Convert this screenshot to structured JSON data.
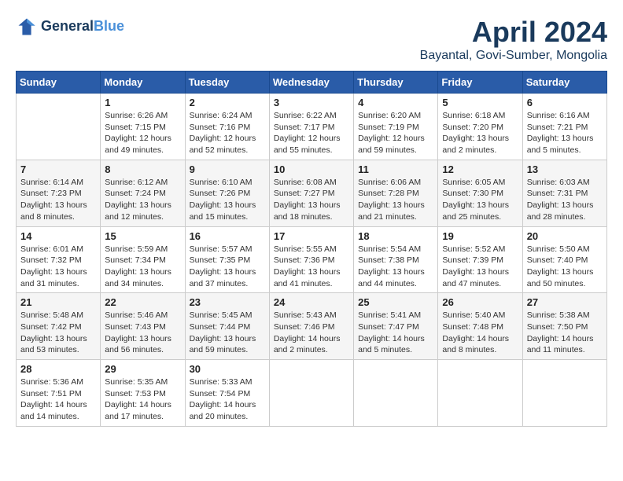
{
  "logo": {
    "line1": "General",
    "line2": "Blue"
  },
  "title": "April 2024",
  "subtitle": "Bayantal, Govi-Sumber, Mongolia",
  "weekdays": [
    "Sunday",
    "Monday",
    "Tuesday",
    "Wednesday",
    "Thursday",
    "Friday",
    "Saturday"
  ],
  "weeks": [
    [
      {
        "day": "",
        "info": ""
      },
      {
        "day": "1",
        "info": "Sunrise: 6:26 AM\nSunset: 7:15 PM\nDaylight: 12 hours\nand 49 minutes."
      },
      {
        "day": "2",
        "info": "Sunrise: 6:24 AM\nSunset: 7:16 PM\nDaylight: 12 hours\nand 52 minutes."
      },
      {
        "day": "3",
        "info": "Sunrise: 6:22 AM\nSunset: 7:17 PM\nDaylight: 12 hours\nand 55 minutes."
      },
      {
        "day": "4",
        "info": "Sunrise: 6:20 AM\nSunset: 7:19 PM\nDaylight: 12 hours\nand 59 minutes."
      },
      {
        "day": "5",
        "info": "Sunrise: 6:18 AM\nSunset: 7:20 PM\nDaylight: 13 hours\nand 2 minutes."
      },
      {
        "day": "6",
        "info": "Sunrise: 6:16 AM\nSunset: 7:21 PM\nDaylight: 13 hours\nand 5 minutes."
      }
    ],
    [
      {
        "day": "7",
        "info": "Sunrise: 6:14 AM\nSunset: 7:23 PM\nDaylight: 13 hours\nand 8 minutes."
      },
      {
        "day": "8",
        "info": "Sunrise: 6:12 AM\nSunset: 7:24 PM\nDaylight: 13 hours\nand 12 minutes."
      },
      {
        "day": "9",
        "info": "Sunrise: 6:10 AM\nSunset: 7:26 PM\nDaylight: 13 hours\nand 15 minutes."
      },
      {
        "day": "10",
        "info": "Sunrise: 6:08 AM\nSunset: 7:27 PM\nDaylight: 13 hours\nand 18 minutes."
      },
      {
        "day": "11",
        "info": "Sunrise: 6:06 AM\nSunset: 7:28 PM\nDaylight: 13 hours\nand 21 minutes."
      },
      {
        "day": "12",
        "info": "Sunrise: 6:05 AM\nSunset: 7:30 PM\nDaylight: 13 hours\nand 25 minutes."
      },
      {
        "day": "13",
        "info": "Sunrise: 6:03 AM\nSunset: 7:31 PM\nDaylight: 13 hours\nand 28 minutes."
      }
    ],
    [
      {
        "day": "14",
        "info": "Sunrise: 6:01 AM\nSunset: 7:32 PM\nDaylight: 13 hours\nand 31 minutes."
      },
      {
        "day": "15",
        "info": "Sunrise: 5:59 AM\nSunset: 7:34 PM\nDaylight: 13 hours\nand 34 minutes."
      },
      {
        "day": "16",
        "info": "Sunrise: 5:57 AM\nSunset: 7:35 PM\nDaylight: 13 hours\nand 37 minutes."
      },
      {
        "day": "17",
        "info": "Sunrise: 5:55 AM\nSunset: 7:36 PM\nDaylight: 13 hours\nand 41 minutes."
      },
      {
        "day": "18",
        "info": "Sunrise: 5:54 AM\nSunset: 7:38 PM\nDaylight: 13 hours\nand 44 minutes."
      },
      {
        "day": "19",
        "info": "Sunrise: 5:52 AM\nSunset: 7:39 PM\nDaylight: 13 hours\nand 47 minutes."
      },
      {
        "day": "20",
        "info": "Sunrise: 5:50 AM\nSunset: 7:40 PM\nDaylight: 13 hours\nand 50 minutes."
      }
    ],
    [
      {
        "day": "21",
        "info": "Sunrise: 5:48 AM\nSunset: 7:42 PM\nDaylight: 13 hours\nand 53 minutes."
      },
      {
        "day": "22",
        "info": "Sunrise: 5:46 AM\nSunset: 7:43 PM\nDaylight: 13 hours\nand 56 minutes."
      },
      {
        "day": "23",
        "info": "Sunrise: 5:45 AM\nSunset: 7:44 PM\nDaylight: 13 hours\nand 59 minutes."
      },
      {
        "day": "24",
        "info": "Sunrise: 5:43 AM\nSunset: 7:46 PM\nDaylight: 14 hours\nand 2 minutes."
      },
      {
        "day": "25",
        "info": "Sunrise: 5:41 AM\nSunset: 7:47 PM\nDaylight: 14 hours\nand 5 minutes."
      },
      {
        "day": "26",
        "info": "Sunrise: 5:40 AM\nSunset: 7:48 PM\nDaylight: 14 hours\nand 8 minutes."
      },
      {
        "day": "27",
        "info": "Sunrise: 5:38 AM\nSunset: 7:50 PM\nDaylight: 14 hours\nand 11 minutes."
      }
    ],
    [
      {
        "day": "28",
        "info": "Sunrise: 5:36 AM\nSunset: 7:51 PM\nDaylight: 14 hours\nand 14 minutes."
      },
      {
        "day": "29",
        "info": "Sunrise: 5:35 AM\nSunset: 7:53 PM\nDaylight: 14 hours\nand 17 minutes."
      },
      {
        "day": "30",
        "info": "Sunrise: 5:33 AM\nSunset: 7:54 PM\nDaylight: 14 hours\nand 20 minutes."
      },
      {
        "day": "",
        "info": ""
      },
      {
        "day": "",
        "info": ""
      },
      {
        "day": "",
        "info": ""
      },
      {
        "day": "",
        "info": ""
      }
    ]
  ]
}
